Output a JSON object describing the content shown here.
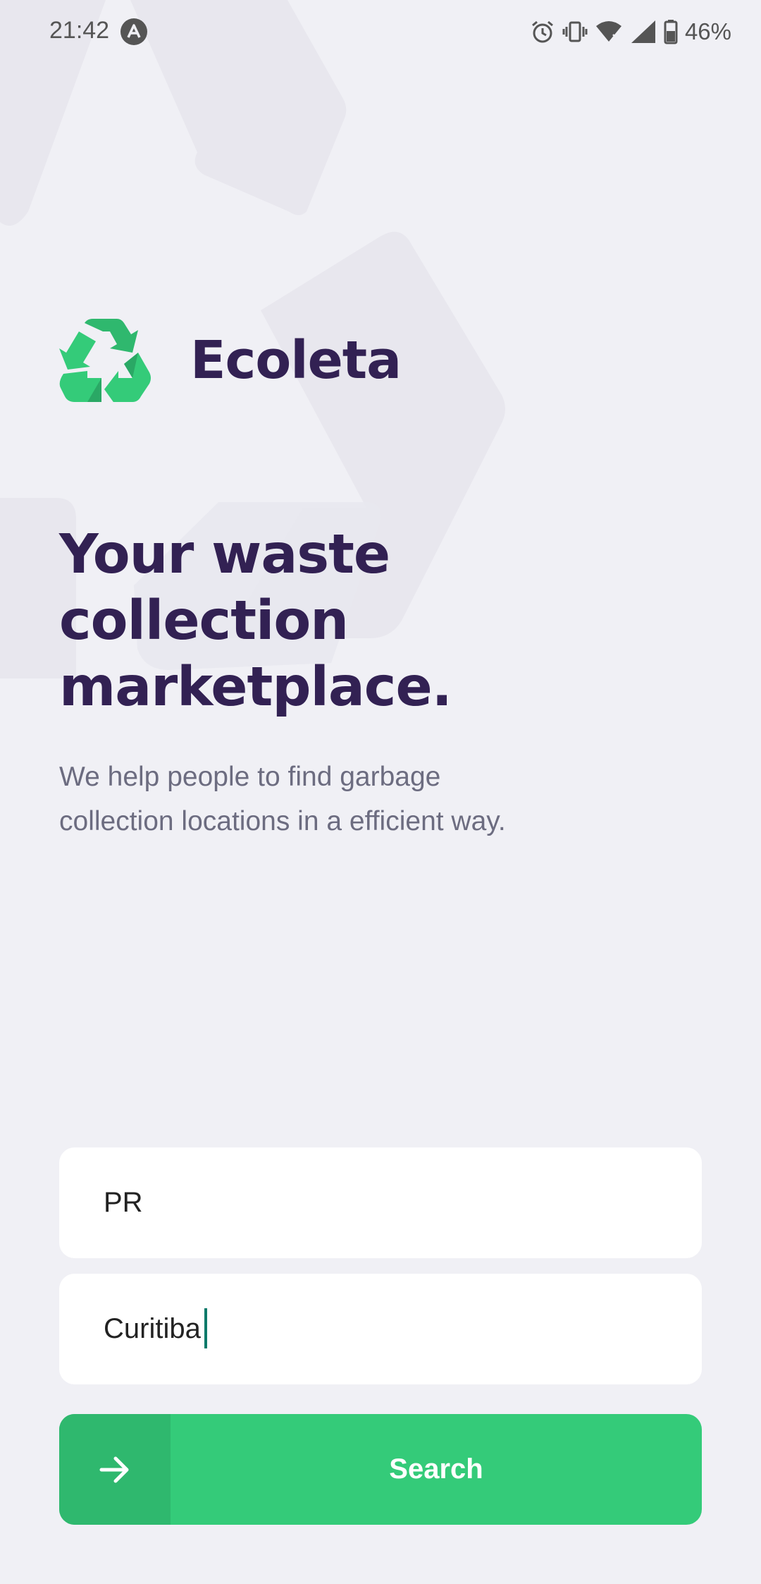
{
  "status_bar": {
    "time": "21:42",
    "battery": "46%",
    "icons": [
      "app-notification-icon",
      "alarm-icon",
      "vibrate-icon",
      "wifi-icon",
      "cell-signal-icon",
      "battery-icon"
    ]
  },
  "brand": {
    "name": "Ecoleta",
    "logo_icon": "recycle-icon",
    "accent_color": "#34cb79",
    "title_color": "#322153"
  },
  "hero": {
    "title_line1": "Your waste",
    "title_line2": "collection",
    "title_line3": "marketplace.",
    "description": "We help people to find garbage collection locations in a efficient way."
  },
  "form": {
    "uf_value": "PR",
    "city_value": "Curitiba",
    "search_label": "Search",
    "search_icon": "arrow-right-icon"
  }
}
